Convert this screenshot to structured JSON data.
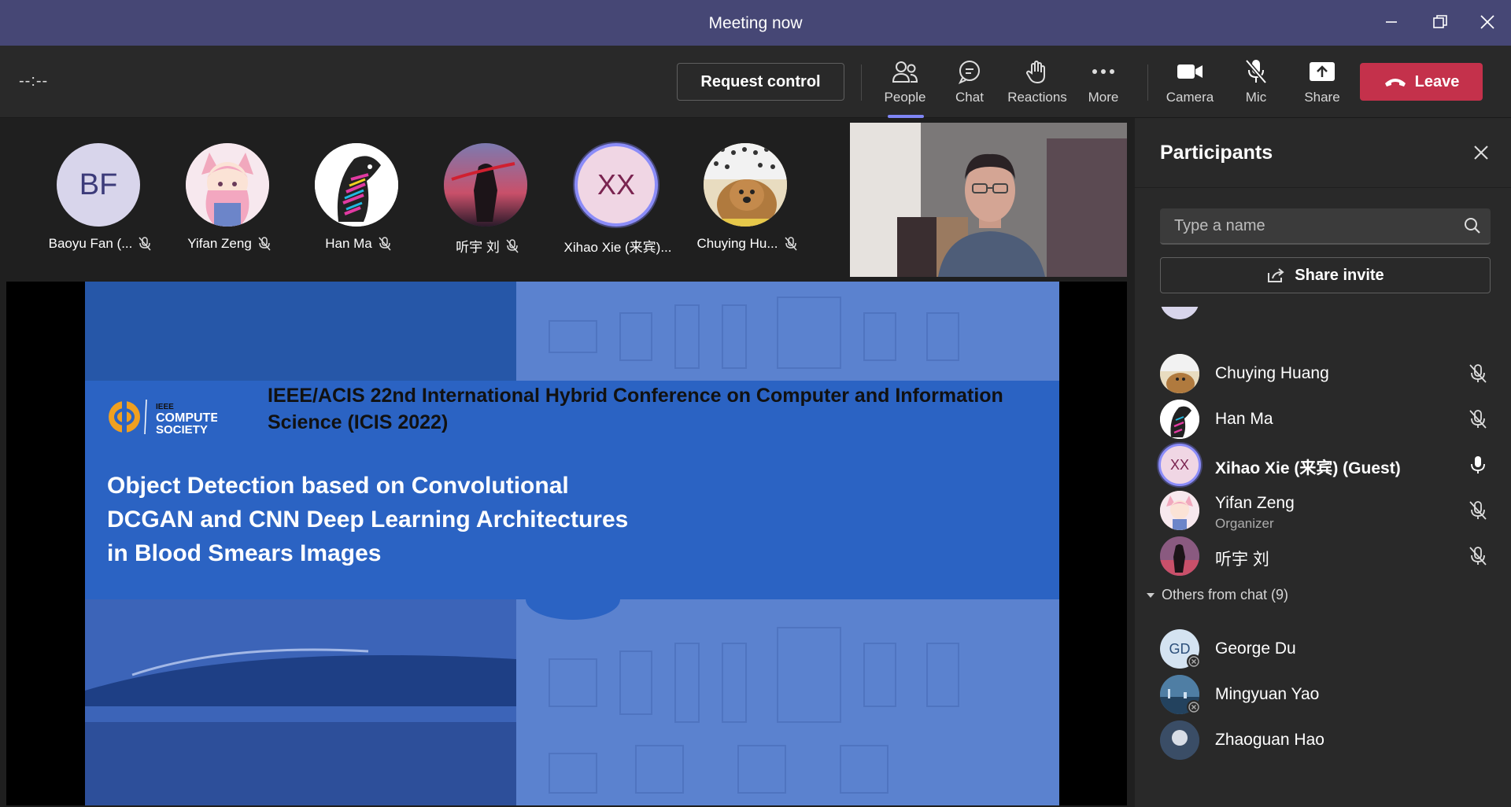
{
  "window": {
    "title": "Meeting now"
  },
  "toolbar": {
    "timer": "--:--",
    "request_control": "Request control",
    "buttons": {
      "people": "People",
      "chat": "Chat",
      "reactions": "Reactions",
      "more": "More",
      "camera": "Camera",
      "mic": "Mic",
      "share": "Share"
    },
    "leave": "Leave"
  },
  "gallery": [
    {
      "name": "Baoyu Fan (...",
      "initials": "BF",
      "muted": true
    },
    {
      "name": "Yifan Zeng",
      "muted": true
    },
    {
      "name": "Han Ma",
      "muted": true
    },
    {
      "name": "听宇 刘",
      "muted": true
    },
    {
      "name": "Xihao Xie (来宾)...",
      "initials": "XX",
      "muted": false,
      "speaking": true
    },
    {
      "name": "Chuying Hu...",
      "muted": true
    }
  ],
  "slide": {
    "logo_text": "IEEE COMPUTER SOCIETY",
    "logo_line1": "IEEE",
    "logo_line2": "COMPUTER",
    "logo_line3": "SOCIETY",
    "conference": "IEEE/ACIS 22nd International Hybrid Conference on Computer and Information Science (ICIS 2022)",
    "paper_title": "Object Detection based on Convolutional\nDCGAN and CNN Deep Learning Architectures\n in Blood Smears Images"
  },
  "participants": {
    "title": "Participants",
    "search_placeholder": "Type a name",
    "share_invite": "Share invite",
    "in_meeting": [
      {
        "name": "Chuying Huang",
        "muted": true
      },
      {
        "name": "Han Ma",
        "muted": true
      },
      {
        "name": "Xihao Xie (来宾) (Guest)",
        "initials": "XX",
        "muted": false,
        "speaking": true
      },
      {
        "name": "Yifan Zeng",
        "role": "Organizer",
        "muted": true
      },
      {
        "name": "听宇 刘",
        "muted": true
      }
    ],
    "others_header": "Others from chat (9)",
    "others": [
      {
        "name": "George Du",
        "initials": "GD"
      },
      {
        "name": "Mingyuan Yao"
      },
      {
        "name": "Zhaoguan Hao"
      }
    ]
  },
  "colors": {
    "titlebar": "#464775",
    "accent": "#7f85f5",
    "leave": "#c4314b",
    "slide_blue": "#2b63c3"
  }
}
